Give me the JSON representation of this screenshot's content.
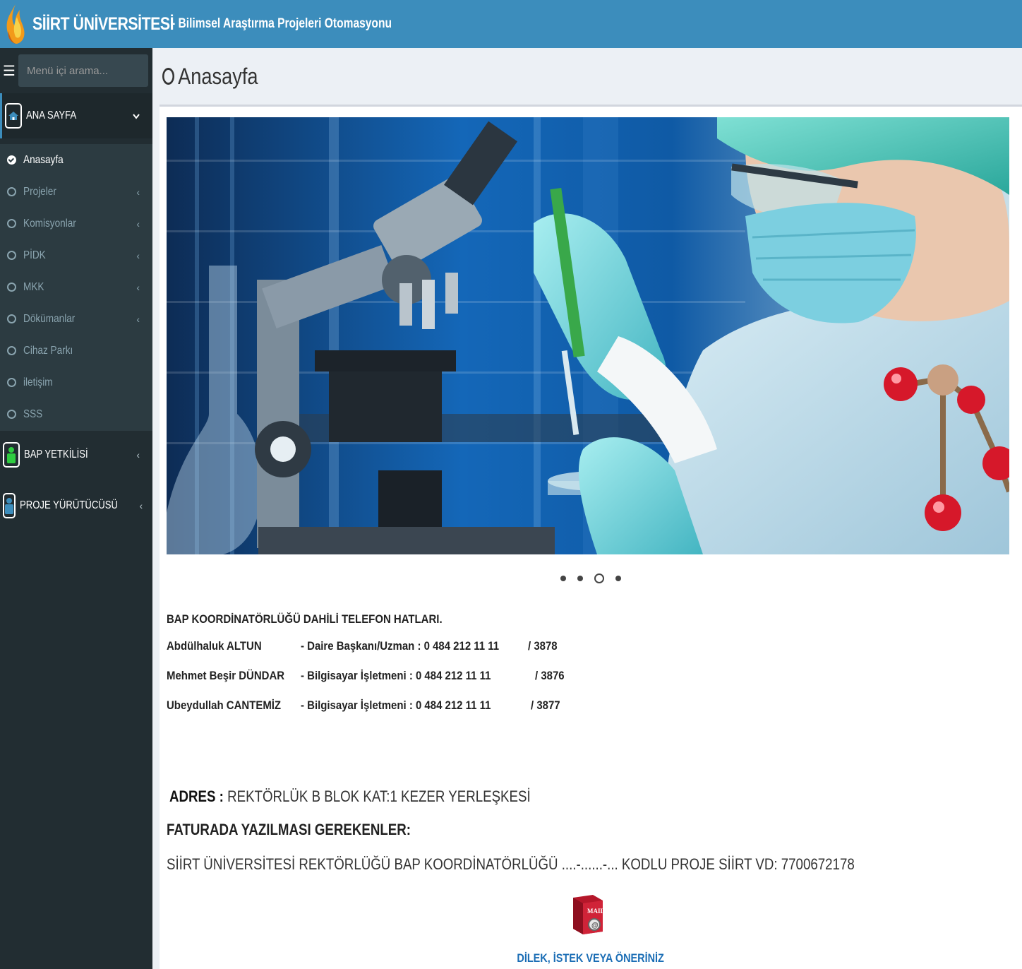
{
  "header": {
    "brand": "SİİRT ÜNİVERSİTESİ",
    "subtitle": "- Bilimsel Araştırma Projeleri Otomasyonu"
  },
  "sidebar": {
    "search_placeholder": "Menü içi arama...",
    "sections": [
      {
        "label": "ANA SAYFA",
        "icon": "home-icon"
      },
      {
        "label": "BAP YETKİLİSİ",
        "icon": "user-green-icon"
      },
      {
        "label": "PROJE YÜRÜTÜCÜSÜ",
        "icon": "user-blue-icon"
      }
    ],
    "items": [
      {
        "label": "Anasayfa"
      },
      {
        "label": "Projeler"
      },
      {
        "label": "Komisyonlar"
      },
      {
        "label": "PİDK"
      },
      {
        "label": "MKK"
      },
      {
        "label": "Dökümanlar"
      },
      {
        "label": "Cihaz Parkı"
      },
      {
        "label": "iletişim"
      },
      {
        "label": "SSS"
      }
    ]
  },
  "page": {
    "title": "Anasayfa"
  },
  "carousel": {
    "slide_count": 4,
    "active_index": 2
  },
  "contacts": {
    "title": "BAP KOORDİNATÖRLÜĞÜ DAHİLİ TELEFON HATLARI.",
    "rows": [
      {
        "name": "Abdülhaluk ALTUN",
        "role": "-  Daire Başkanı/Uzman : 0 484 212 11 11",
        "ext": "/ 3878"
      },
      {
        "name": "Mehmet Beşir DÜNDAR",
        "role": "-  Bilgisayar İşletmeni   : 0 484 212 11 11",
        "ext": "/ 3876"
      },
      {
        "name": "Ubeydullah CANTEMİZ",
        "role": "-  Bilgisayar İşletmeni   : 0 484 212 11 11",
        "ext": "/ 3877"
      }
    ]
  },
  "address": {
    "label": "ADRES :",
    "value": "REKTÖRLÜK B BLOK KAT:1 KEZER YERLEŞKESİ"
  },
  "invoice": {
    "title": "FATURADA YAZILMASI GEREKENLER:",
    "text": "SİİRT ÜNİVERSİTESİ REKTÖRLÜĞÜ BAP KOORDİNATÖRLÜĞÜ ....-......-... KODLU PROJE SİİRT VD: 7700672178"
  },
  "mail": {
    "icon_text": "MAIL",
    "link_label": "DİLEK, İSTEK VEYA ÖNERİNİZ"
  },
  "colors": {
    "header": "#3c8dbc",
    "sidebar": "#222d32",
    "link": "#1a6db5"
  }
}
